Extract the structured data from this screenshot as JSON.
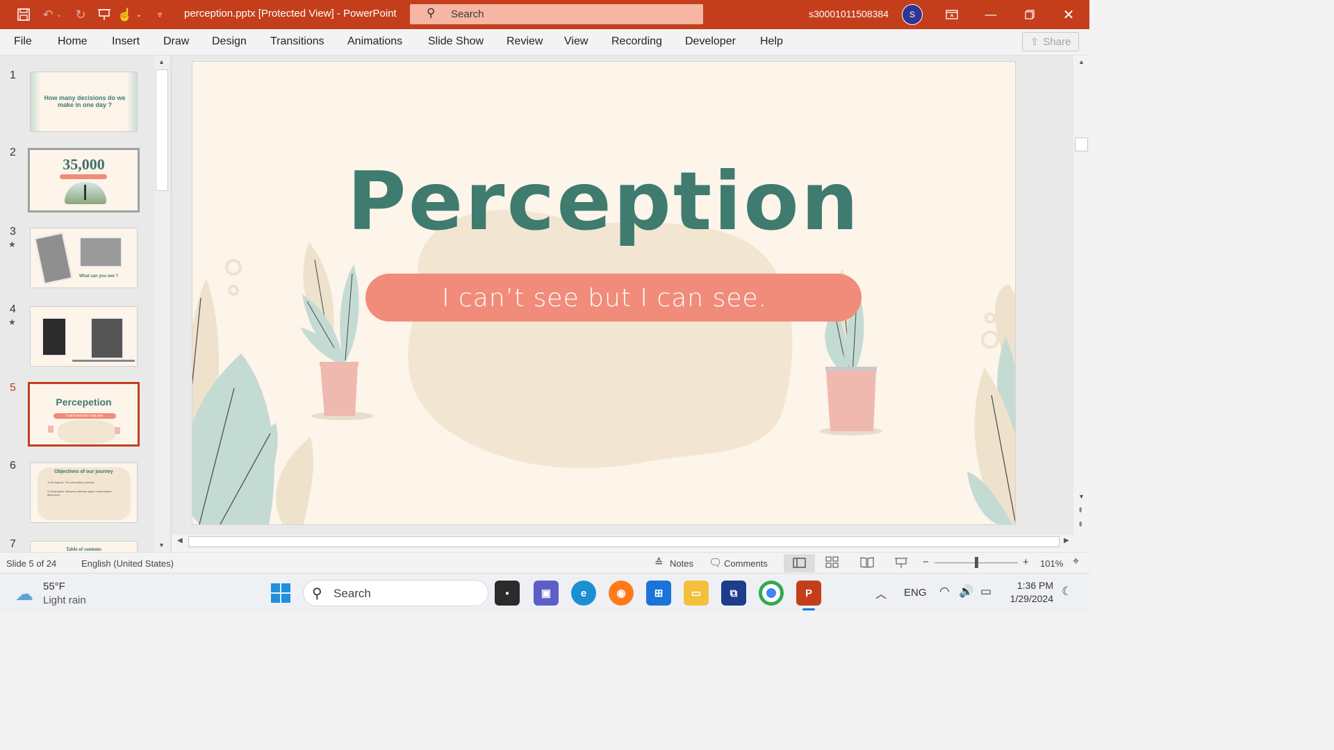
{
  "titlebar": {
    "document_title": "perception.pptx [Protected View]  -  PowerPoint",
    "search_label": "Search",
    "account": "s30001011508384",
    "avatar_initial": "S"
  },
  "ribbon": {
    "tabs": [
      "File",
      "Home",
      "Insert",
      "Draw",
      "Design",
      "Transitions",
      "Animations",
      "Slide Show",
      "Review",
      "View",
      "Recording",
      "Developer",
      "Help"
    ],
    "share_label": "Share"
  },
  "thumbnails": [
    {
      "number": "1",
      "title": "How many decisions do  we make in one day ?"
    },
    {
      "number": "2",
      "title": "35,000"
    },
    {
      "number": "3",
      "title": "What can you see ?",
      "has_animation": true
    },
    {
      "number": "4",
      "title": "",
      "has_animation": true
    },
    {
      "number": "5",
      "title": "Percepetion",
      "subtitle": "I can't see but I can see.",
      "selected": true
    },
    {
      "number": "6",
      "title": "Objectives of our journey",
      "items": [
        "1) Recognize:  The perception process",
        "2) Distinguish:  Between different types of perceptual distortions."
      ]
    },
    {
      "number": "7",
      "title": "Table of contents"
    }
  ],
  "slide": {
    "title": "Perception",
    "subtitle": "I can’t see but I can see.",
    "colors": {
      "title": "#3f7b6f",
      "banner": "#f18c7a",
      "background": "#fdf4ea",
      "blob": "#f2e6d3",
      "leaf_green": "#c4dbd3",
      "pot": "#efb9b0"
    }
  },
  "statusbar": {
    "slide_info": "Slide 5 of 24",
    "language": "English (United States)",
    "notes": "Notes",
    "comments": "Comments",
    "zoom": "101%"
  },
  "taskbar": {
    "weather_temp": "55°F",
    "weather_desc": "Light rain",
    "search_label": "Search",
    "language": "ENG",
    "time": "1:36 PM",
    "date": "1/29/2024"
  }
}
